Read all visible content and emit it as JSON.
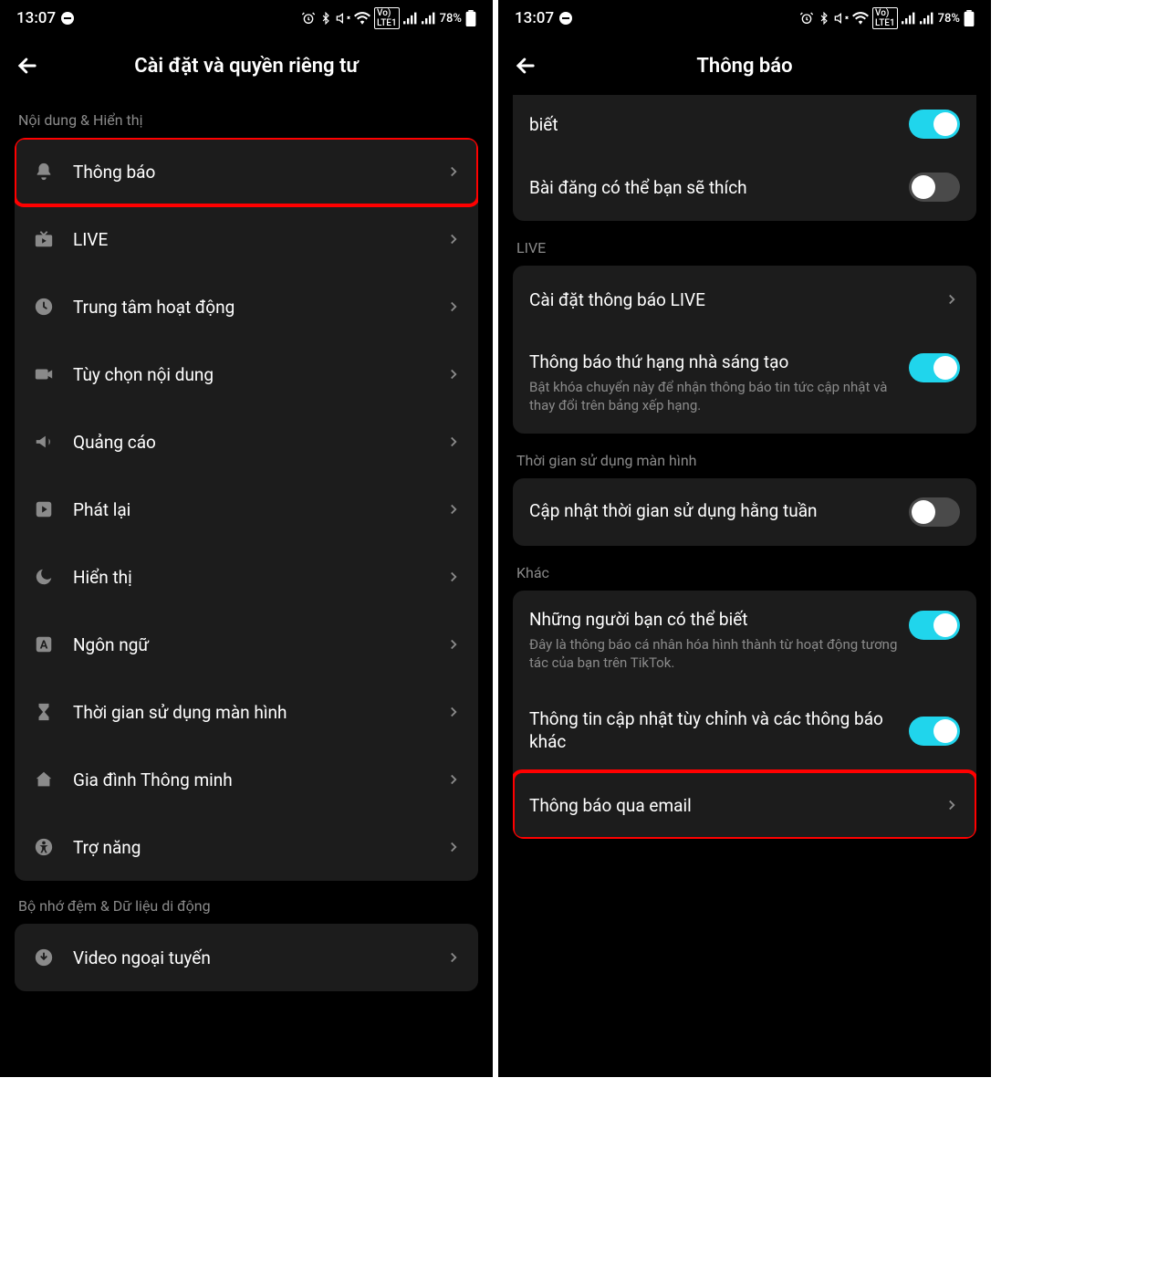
{
  "status": {
    "time": "13:07",
    "battery": "78%"
  },
  "left": {
    "title": "Cài đặt và quyền riêng tư",
    "section1": "Nội dung & Hiển thị",
    "items": [
      {
        "label": "Thông báo",
        "icon": "bell"
      },
      {
        "label": "LIVE",
        "icon": "tv"
      },
      {
        "label": "Trung tâm hoạt động",
        "icon": "clock"
      },
      {
        "label": "Tùy chọn nội dung",
        "icon": "camera"
      },
      {
        "label": "Quảng cáo",
        "icon": "megaphone"
      },
      {
        "label": "Phát lại",
        "icon": "play"
      },
      {
        "label": "Hiển thị",
        "icon": "moon"
      },
      {
        "label": "Ngôn ngữ",
        "icon": "lang"
      },
      {
        "label": "Thời gian sử dụng màn hình",
        "icon": "hourglass"
      },
      {
        "label": "Gia đình Thông minh",
        "icon": "home"
      },
      {
        "label": "Trợ năng",
        "icon": "accessibility"
      }
    ],
    "section2": "Bộ nhớ đệm & Dữ liệu di động",
    "items2": [
      {
        "label": "Video ngoại tuyến",
        "icon": "download"
      }
    ]
  },
  "right": {
    "title": "Thông báo",
    "top_partial": "biết",
    "row_posts": "Bài đăng có thể bạn sẽ thích",
    "sec_live": "LIVE",
    "row_live_settings": "Cài đặt thông báo LIVE",
    "row_creator_rank": "Thông báo thứ hạng nhà sáng tạo",
    "row_creator_rank_sub": "Bật khóa chuyển này để nhận thông báo tin tức cập nhật và thay đổi trên bảng xếp hạng.",
    "sec_screentime": "Thời gian sử dụng màn hình",
    "row_weekly": "Cập nhật thời gian sử dụng hằng tuần",
    "sec_other": "Khác",
    "row_people": "Những người bạn có thể biết",
    "row_people_sub": "Đây là thông báo cá nhân hóa hình thành từ hoạt động tương tác của bạn trên TikTok.",
    "row_custom": "Thông tin cập nhật tùy chỉnh và các thông báo khác",
    "row_email": "Thông báo qua email"
  }
}
